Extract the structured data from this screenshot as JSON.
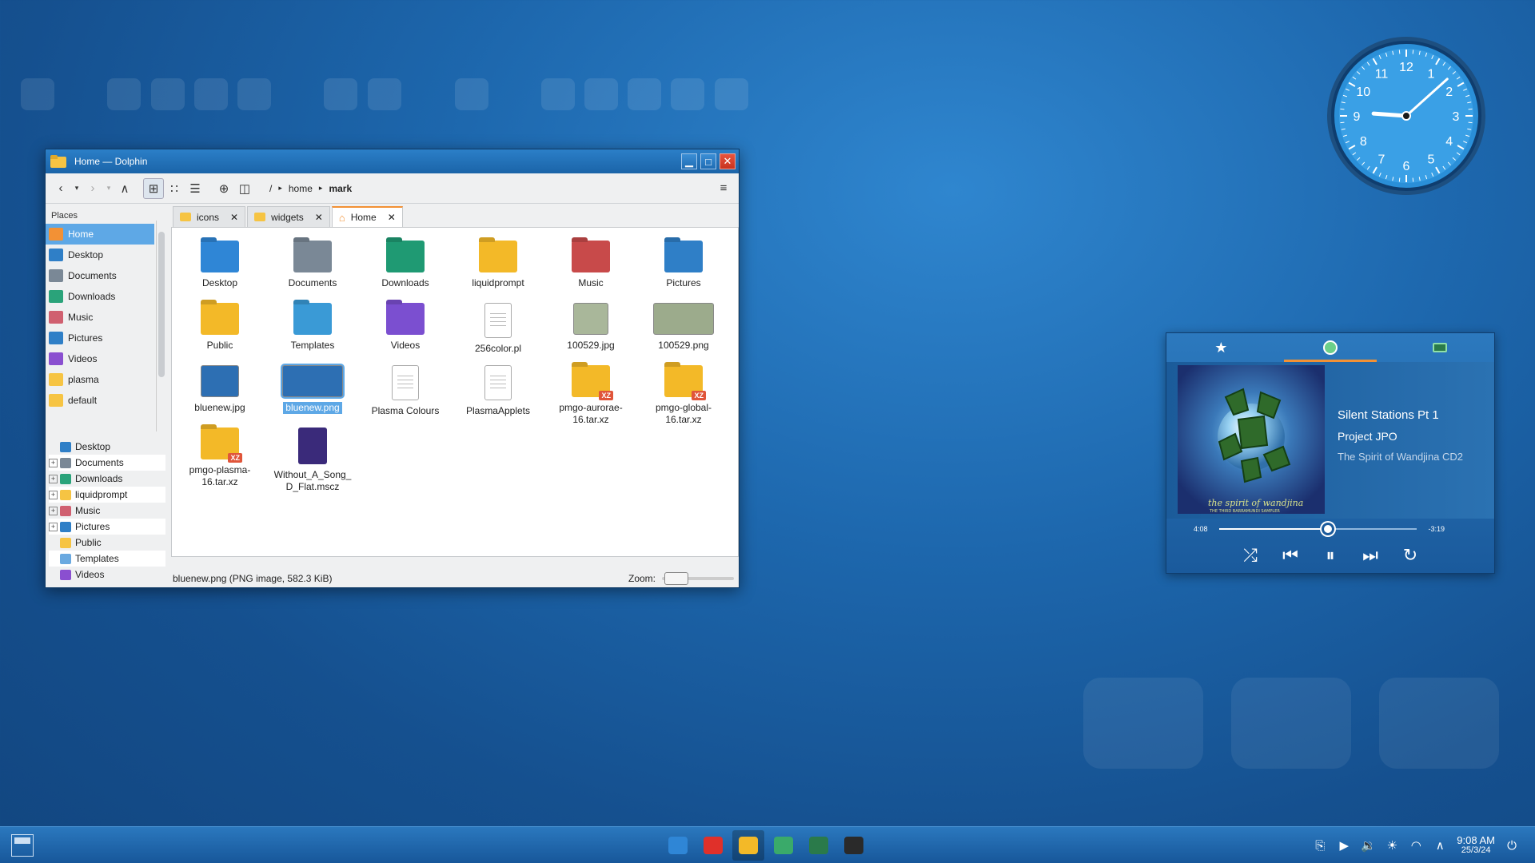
{
  "window": {
    "title": "Home — Dolphin",
    "buttons": {
      "minimize": "▁",
      "maximize": "□",
      "close": "✕"
    }
  },
  "toolbar": {
    "breadcrumb_root": "/",
    "breadcrumb": [
      "home",
      "mark"
    ],
    "icons": [
      "back-icon",
      "forward-icon",
      "up-icon",
      "icons-view-icon",
      "compact-view-icon",
      "details-view-icon",
      "new-tab-icon",
      "split-view-icon",
      "hamburger-menu-icon"
    ]
  },
  "places": {
    "header": "Places",
    "items": [
      {
        "label": "Home",
        "color": "#f29135",
        "selected": true
      },
      {
        "label": "Desktop",
        "color": "#2f7fc7"
      },
      {
        "label": "Documents",
        "color": "#7a8896"
      },
      {
        "label": "Downloads",
        "color": "#2aa37a"
      },
      {
        "label": "Music",
        "color": "#d06070"
      },
      {
        "label": "Pictures",
        "color": "#2f7fc7"
      },
      {
        "label": "Videos",
        "color": "#8a4fd0"
      },
      {
        "label": "plasma",
        "color": "#f6c443"
      },
      {
        "label": "default",
        "color": "#f6c443"
      }
    ]
  },
  "tree": {
    "items": [
      {
        "label": "Desktop",
        "expander": false,
        "color": "#2f7fc7"
      },
      {
        "label": "Documents",
        "expander": true,
        "color": "#7a8896"
      },
      {
        "label": "Downloads",
        "expander": true,
        "color": "#2aa37a"
      },
      {
        "label": "liquidprompt",
        "expander": true,
        "color": "#f6c443"
      },
      {
        "label": "Music",
        "expander": true,
        "color": "#d06070"
      },
      {
        "label": "Pictures",
        "expander": true,
        "color": "#2f7fc7"
      },
      {
        "label": "Public",
        "expander": false,
        "color": "#f6c443"
      },
      {
        "label": "Templates",
        "expander": false,
        "color": "#6aa9e0"
      },
      {
        "label": "Videos",
        "expander": false,
        "color": "#8a4fd0"
      }
    ]
  },
  "tabs": [
    {
      "label": "icons",
      "active": false
    },
    {
      "label": "widgets",
      "active": false
    },
    {
      "label": "Home",
      "active": true
    }
  ],
  "tab_close": "✕",
  "files": [
    {
      "label": "Desktop",
      "kind": "folder",
      "color": "#2f86d6"
    },
    {
      "label": "Documents",
      "kind": "folder",
      "color": "#7a8896"
    },
    {
      "label": "Downloads",
      "kind": "folder",
      "color": "#1f9a73"
    },
    {
      "label": "liquidprompt",
      "kind": "folder",
      "color": "#f3b928"
    },
    {
      "label": "Music",
      "kind": "folder",
      "color": "#c84a4a"
    },
    {
      "label": "Pictures",
      "kind": "folder",
      "color": "#2f7fc7"
    },
    {
      "label": "Public",
      "kind": "folder",
      "color": "#f3b928"
    },
    {
      "label": "Templates",
      "kind": "folder",
      "color": "#3a9ad6"
    },
    {
      "label": "Videos",
      "kind": "folder",
      "color": "#7b4fd0"
    },
    {
      "label": "256color.pl",
      "kind": "doc"
    },
    {
      "label": "100529.jpg",
      "kind": "image",
      "color": "#a9b79a"
    },
    {
      "label": "100529.png",
      "kind": "image",
      "color": "#9cab8c"
    },
    {
      "label": "bluenew.jpg",
      "kind": "image",
      "color": "#2d6fb3"
    },
    {
      "label": "bluenew.png",
      "kind": "image",
      "color": "#2d6fb3",
      "selected": true
    },
    {
      "label": "Plasma Colours",
      "kind": "doc"
    },
    {
      "label": "PlasmaApplets",
      "kind": "doc"
    },
    {
      "label": "pmgo-aurorae-16.tar.xz",
      "kind": "archive",
      "color": "#f3b928"
    },
    {
      "label": "pmgo-global-16.tar.xz",
      "kind": "archive",
      "color": "#f3b928"
    },
    {
      "label": "pmgo-plasma-16.tar.xz",
      "kind": "archive",
      "color": "#f3b928"
    },
    {
      "label": "Without_A_Song_D_Flat.mscz",
      "kind": "app",
      "color": "#3a2a7a"
    }
  ],
  "status": {
    "text": "bluenew.png (PNG image, 582.3 KiB)",
    "zoom_label": "Zoom:",
    "zoom_level": 0.05
  },
  "clock": {
    "numbers": [
      "12",
      "1",
      "2",
      "3",
      "4",
      "5",
      "6",
      "7",
      "8",
      "9",
      "10",
      "11"
    ],
    "hour": 9,
    "minute": 8
  },
  "media": {
    "tabs": [
      "star-icon",
      "media-player-icon",
      "display-icon"
    ],
    "title": "Silent Stations Pt 1",
    "artist": "Project JPO",
    "album": "The Spirit of Wandjina CD2",
    "cover_text": "the spirit of wandjina",
    "cover_subtext": "THE THIRD BARRAMUNDI SAMPLER",
    "elapsed": "4:08",
    "remaining": "-3:19",
    "progress": 0.55
  },
  "taskbar": {
    "tasks": [
      {
        "name": "network-task",
        "color": "#2f86d6"
      },
      {
        "name": "vivaldi-task",
        "color": "#e0302a"
      },
      {
        "name": "dolphin-task",
        "color": "#f3b928",
        "active": true
      },
      {
        "name": "media-task",
        "color": "#3aaa6a"
      },
      {
        "name": "monitor-task",
        "color": "#2a7a4a"
      },
      {
        "name": "terminal-task",
        "color": "#2a2a2a"
      }
    ],
    "time": "9:08 AM",
    "date": "25/3/24"
  }
}
